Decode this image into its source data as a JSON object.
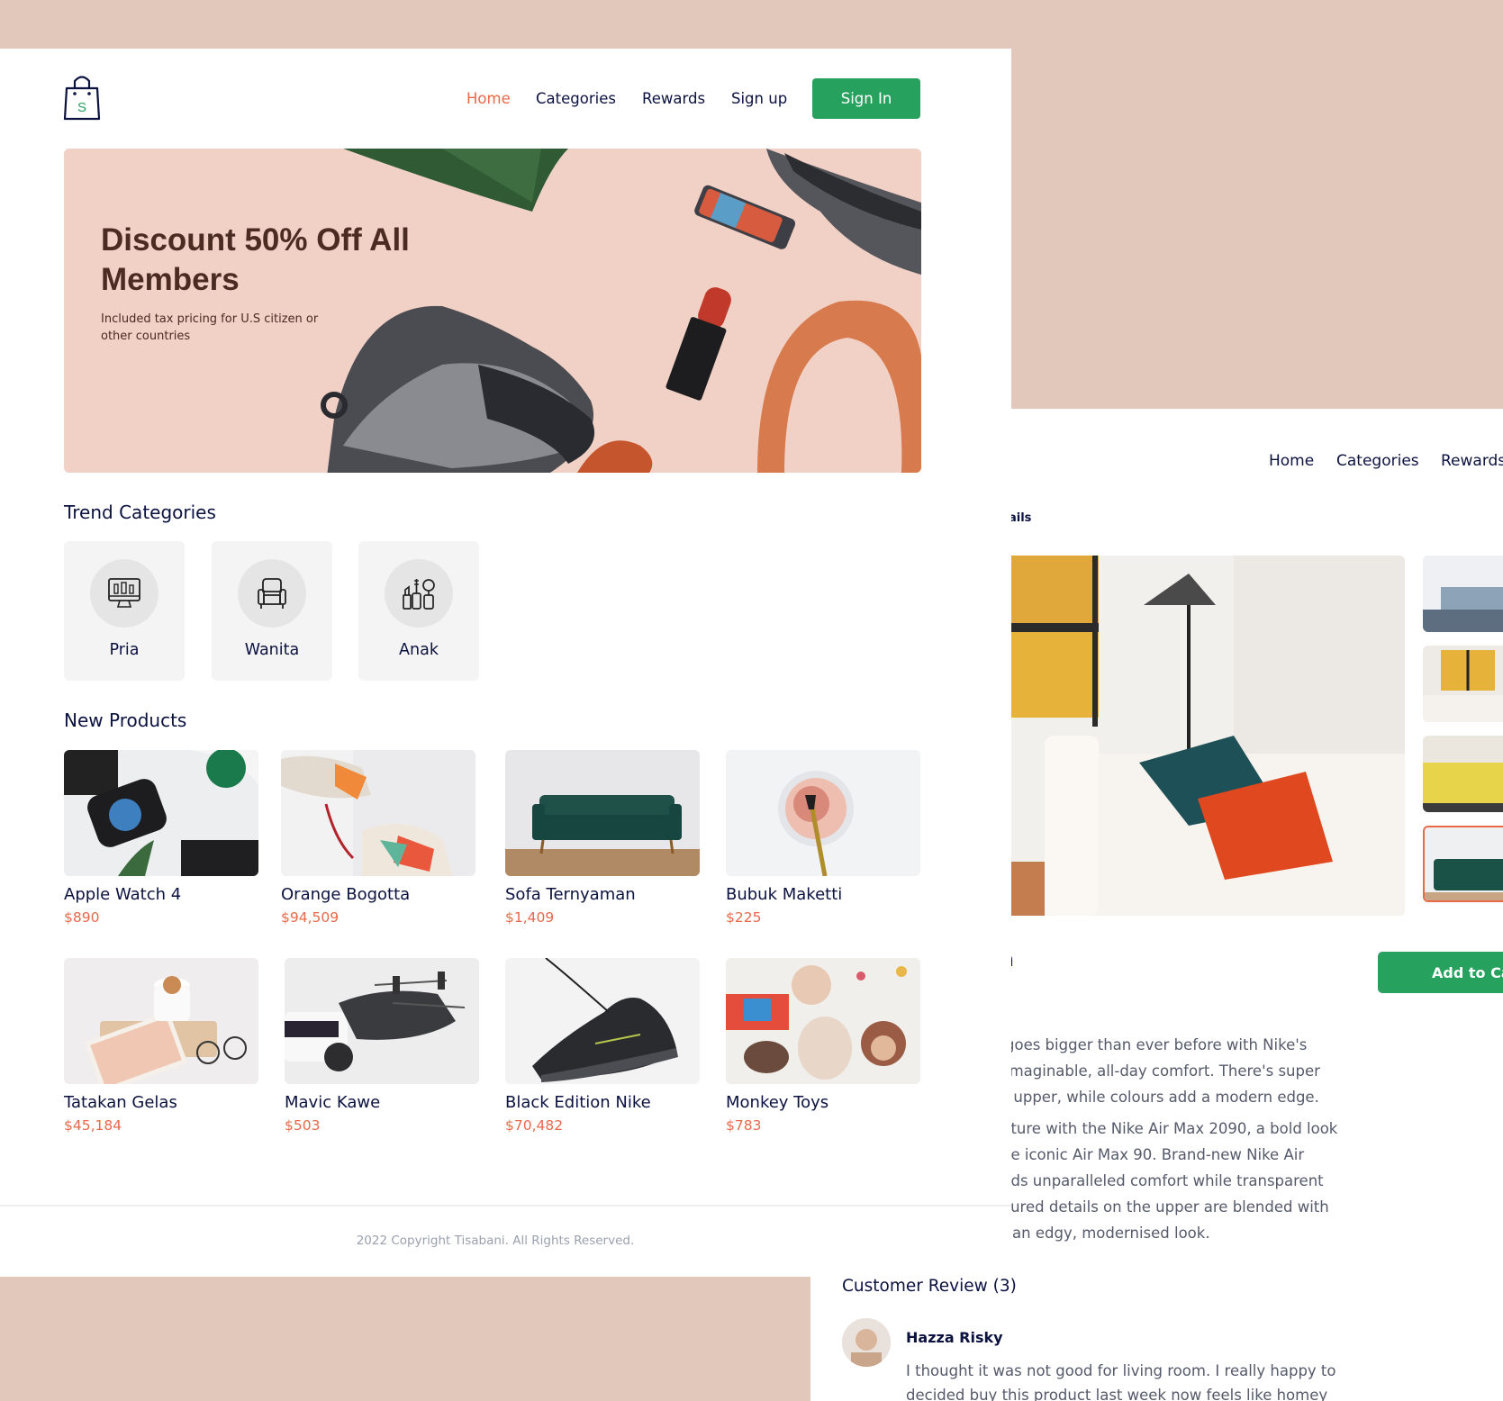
{
  "home": {
    "nav": {
      "home": "Home",
      "categories": "Categories",
      "rewards": "Rewards",
      "signup": "Sign up",
      "signin": "Sign In"
    },
    "hero": {
      "title": "Discount 50% Off All Members",
      "subtitle": "Included tax pricing for U.S citizen or other countries"
    },
    "trend_title": "Trend Categories",
    "categories": [
      {
        "label": "Pria",
        "icon": "monitor-icon"
      },
      {
        "label": "Wanita",
        "icon": "armchair-icon"
      },
      {
        "label": "Anak",
        "icon": "cosmetics-icon"
      }
    ],
    "new_products_title": "New Products",
    "products": [
      {
        "name": "Apple Watch 4",
        "price": "$890"
      },
      {
        "name": "Orange Bogotta",
        "price": "$94,509"
      },
      {
        "name": "Sofa Ternyaman",
        "price": "$1,409"
      },
      {
        "name": "Bubuk Maketti",
        "price": "$225"
      },
      {
        "name": "Tatakan Gelas",
        "price": "$45,184"
      },
      {
        "name": "Mavic Kawe",
        "price": "$503"
      },
      {
        "name": "Black Edition Nike",
        "price": "$70,482"
      },
      {
        "name": "Monkey Toys",
        "price": "$783"
      }
    ],
    "copyright": "2022 Copyright Tisabani. All Rights Reserved."
  },
  "detail": {
    "nav": {
      "home": "Home",
      "categories": "Categories",
      "rewards": "Rewards"
    },
    "breadcrumb": "ails",
    "title_fragment": "n",
    "add_to_cart": "Add to Ca",
    "para1": [
      "goes bigger than ever before with Nike's",
      "imaginable, all-day comfort. There's super",
      "e upper, while colours add a modern edge."
    ],
    "para2": [
      "uture with the Nike Air Max 2090, a bold look",
      "he iconic Air Max 90. Brand-new Nike Air",
      "dds unparalleled comfort while transparent",
      "oured details on the upper are blended with",
      "r an edgy, modernised look."
    ],
    "review_title": "Customer Review (3)",
    "reviewer": "Hazza Risky",
    "review_text": "I thought it was not good for living room. I really happy to decided buy this product last week now feels like homey"
  },
  "colors": {
    "accent_green": "#27a15e",
    "accent_orange": "#e8694a",
    "background": "#e2c7bb",
    "text_dark": "#0b1240"
  }
}
